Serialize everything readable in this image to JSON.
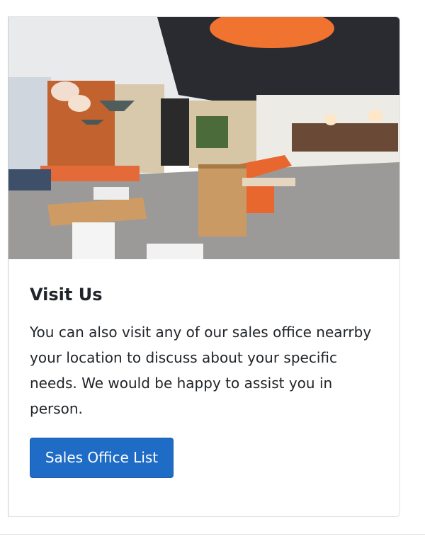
{
  "card": {
    "title": "Visit Us",
    "text": "You can also visit any of our sales office nearrby your location to discuss about your specific needs. We would be happy to assist you in person.",
    "button_label": "Sales Office List"
  },
  "colors": {
    "button": "#1f6cc7",
    "text": "#212529",
    "border": "#dfe1e4",
    "accent_orange": "#f0732f"
  }
}
